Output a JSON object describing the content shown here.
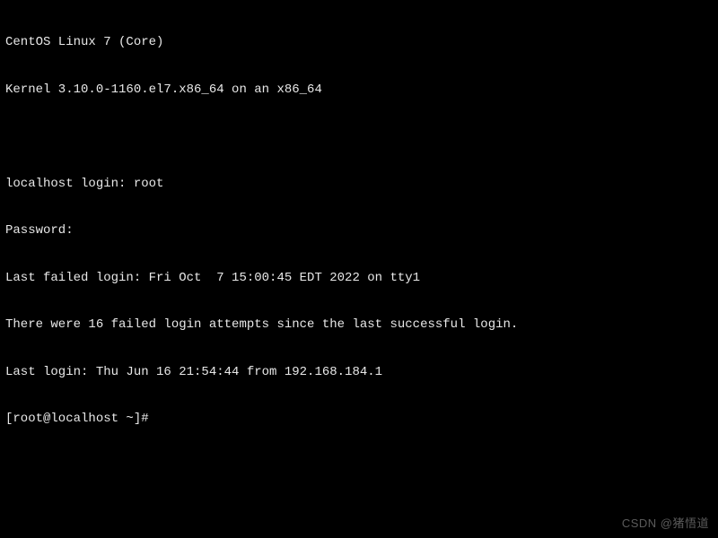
{
  "terminal": {
    "os_name": "CentOS Linux 7 (Core)",
    "kernel_line": "Kernel 3.10.0-1160.el7.x86_64 on an x86_64",
    "login_host_prompt": "localhost login: ",
    "login_user_input": "root",
    "password_prompt": "Password:",
    "last_failed_login": "Last failed login: Fri Oct  7 15:00:45 EDT 2022 on tty1",
    "failed_attempts_msg": "There were 16 failed login attempts since the last successful login.",
    "last_login": "Last login: Thu Jun 16 21:54:44 from 192.168.184.1",
    "shell_prompt": "[root@localhost ~]#"
  },
  "watermark": {
    "text": "CSDN @猪悟道"
  }
}
